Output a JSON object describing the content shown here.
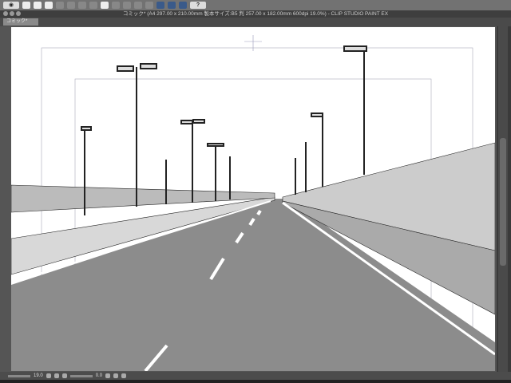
{
  "toolbar": {
    "items": [
      "view-icon",
      "new-file-icon",
      "open-file-icon",
      "save-icon",
      "undo-icon",
      "redo-icon",
      "selection-icon",
      "transform-icon",
      "fill-icon",
      "fit-icon",
      "snap-ruler-icon",
      "snap-grid-icon",
      "snap-special-icon",
      "help-icon"
    ],
    "help_label": "?"
  },
  "window": {
    "title": "コミック* (A4 297.00 x 210.00mm 製本サイズ:B5 判 257.00 x 182.00mm 600dpi 19.0%)  - CLIP STUDIO PAINT EX"
  },
  "tabs": [
    {
      "label": "コミック*",
      "active": true
    }
  ],
  "status": {
    "zoom": "19.0",
    "rotation": "0.0"
  }
}
